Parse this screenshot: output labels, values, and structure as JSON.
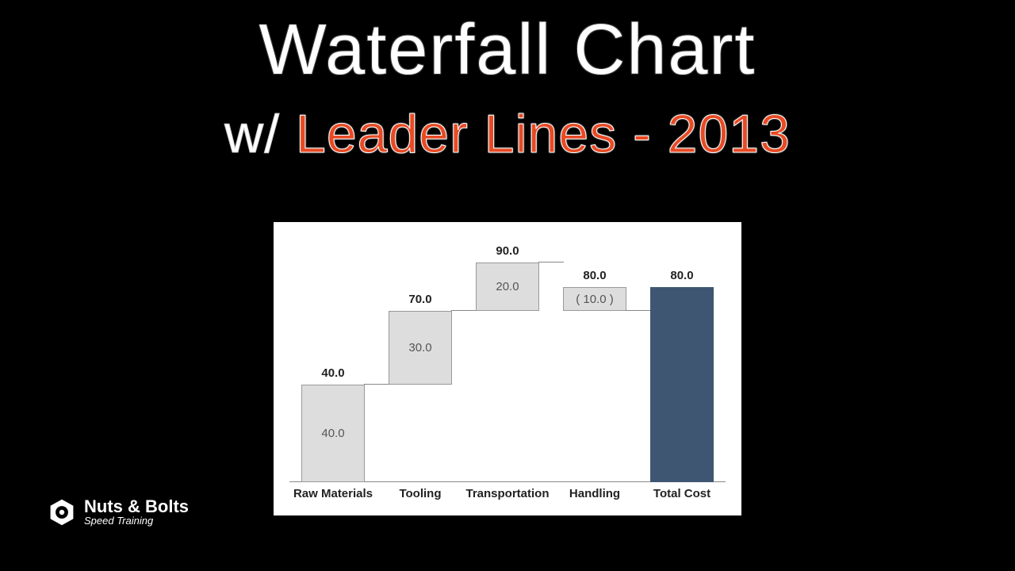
{
  "titles": {
    "main": "Waterfall Chart",
    "sub_prefix": "w/ ",
    "sub_colored": "Leader Lines - 2013"
  },
  "brand": {
    "name": "Nuts & Bolts",
    "tagline": "Speed Training"
  },
  "chart_data": {
    "type": "bar",
    "subtype": "waterfall",
    "categories": [
      "Raw Materials",
      "Tooling",
      "Transportation",
      "Handling",
      "Total Cost"
    ],
    "bars": [
      {
        "category": "Raw Materials",
        "base": 0,
        "delta": 40,
        "cumulative": 40,
        "in_bar_label": "40.0",
        "top_label": "40.0",
        "is_total": false
      },
      {
        "category": "Tooling",
        "base": 40,
        "delta": 30,
        "cumulative": 70,
        "in_bar_label": "30.0",
        "top_label": "70.0",
        "is_total": false
      },
      {
        "category": "Transportation",
        "base": 70,
        "delta": 20,
        "cumulative": 90,
        "in_bar_label": "20.0",
        "top_label": "90.0",
        "is_total": false
      },
      {
        "category": "Handling",
        "base": 80,
        "delta": -10,
        "cumulative": 80,
        "in_bar_label": "( 10.0 )",
        "top_label": "80.0",
        "is_total": false
      },
      {
        "category": "Total Cost",
        "base": 0,
        "delta": 80,
        "cumulative": 80,
        "in_bar_label": "",
        "top_label": "80.0",
        "is_total": true
      }
    ],
    "ylim": [
      0,
      100
    ],
    "xlabel": "",
    "ylabel": "",
    "title": ""
  }
}
